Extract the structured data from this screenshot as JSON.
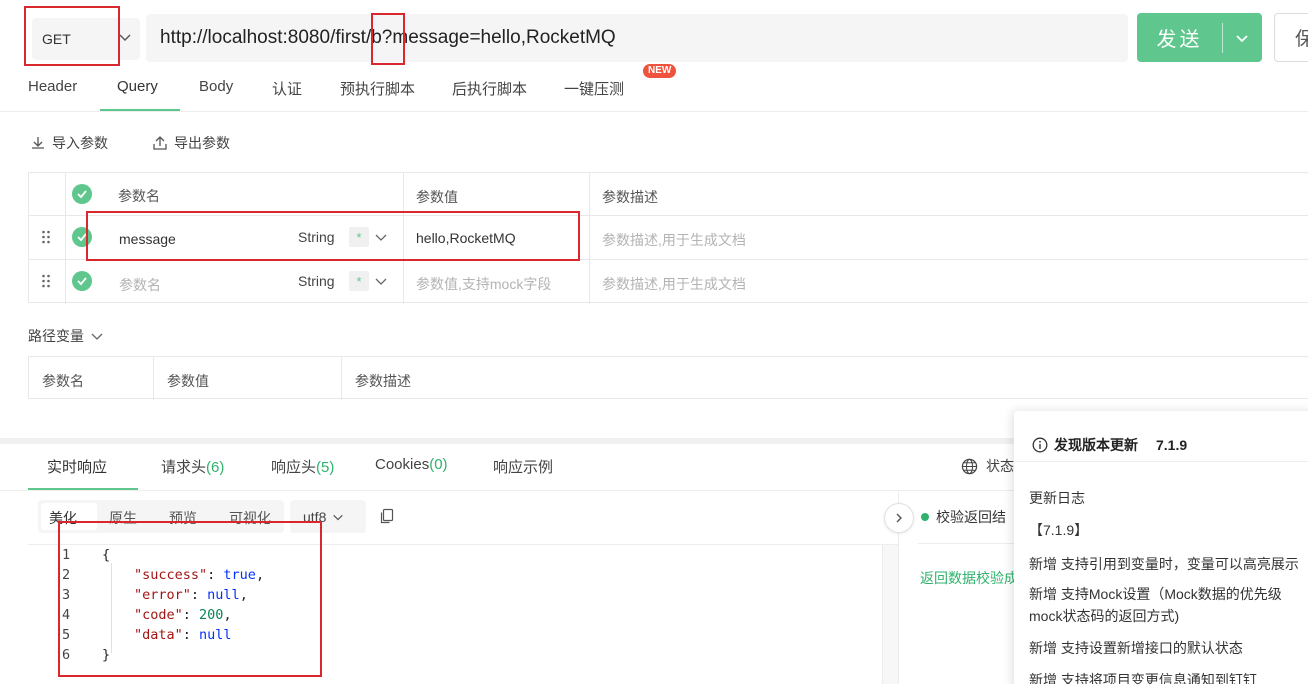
{
  "request": {
    "method": "GET",
    "url": "http://localhost:8080/first/b?message=hello,RocketMQ",
    "send_label": "发送",
    "save_label": "保"
  },
  "tabs": [
    {
      "label": "Header"
    },
    {
      "label": "Query"
    },
    {
      "label": "Body"
    },
    {
      "label": "认证"
    },
    {
      "label": "预执行脚本"
    },
    {
      "label": "后执行脚本"
    },
    {
      "label": "一键压测"
    }
  ],
  "new_badge": "NEW",
  "toolbar": {
    "import_label": "导入参数",
    "export_label": "导出参数"
  },
  "query_table": {
    "headers": {
      "name": "参数名",
      "value": "参数值",
      "desc": "参数描述"
    },
    "rows": [
      {
        "name": "message",
        "type": "String",
        "required": "*",
        "value": "hello,RocketMQ",
        "desc_placeholder": "参数描述,用于生成文档"
      },
      {
        "name_placeholder": "参数名",
        "type": "String",
        "required": "*",
        "value_placeholder": "参数值,支持mock字段",
        "desc_placeholder": "参数描述,用于生成文档"
      }
    ]
  },
  "path_vars": {
    "title": "路径变量",
    "headers": {
      "name": "参数名",
      "value": "参数值",
      "desc": "参数描述"
    }
  },
  "response_tabs": {
    "realtime": "实时响应",
    "req_headers": "请求头",
    "req_headers_count": "(6)",
    "resp_headers": "响应头",
    "resp_headers_count": "(5)",
    "cookies": "Cookies",
    "cookies_count": "(0)",
    "example": "响应示例",
    "status_partial": "状态"
  },
  "view_modes": {
    "pretty": "美化",
    "raw": "原生",
    "preview": "预览",
    "visual": "可视化",
    "encoding": "utf8"
  },
  "code": {
    "line_numbers": [
      "1",
      "2",
      "3",
      "4",
      "5",
      "6"
    ],
    "lines": [
      {
        "open": "{"
      },
      {
        "key": "\"success\"",
        "value": "true",
        "tail": ","
      },
      {
        "key": "\"error\"",
        "value": "null",
        "tail": ","
      },
      {
        "key": "\"code\"",
        "value": "200",
        "tail": ","
      },
      {
        "key": "\"data\"",
        "value": "null",
        "tail": ""
      },
      {
        "close": "}"
      }
    ]
  },
  "validation": {
    "check_label": "校验返回结",
    "link_label": "返回数据校验成"
  },
  "notification": {
    "title": "发现版本更新",
    "version": "7.1.9",
    "log_title": "更新日志",
    "log_version": "【7.1.9】",
    "items": [
      "新增 支持引用到变量时，变量可以高亮展示",
      "新增 支持Mock设置（Mock数据的优先级",
      "mock状态码的返回方式)",
      "新增 支持设置新增接口的默认状态",
      "新增 支持将项目变更信息通知到钉钉"
    ]
  },
  "colors": {
    "accent": "#5fc78e",
    "highlight_box": "#d9272e",
    "badge": "#f0533d"
  }
}
